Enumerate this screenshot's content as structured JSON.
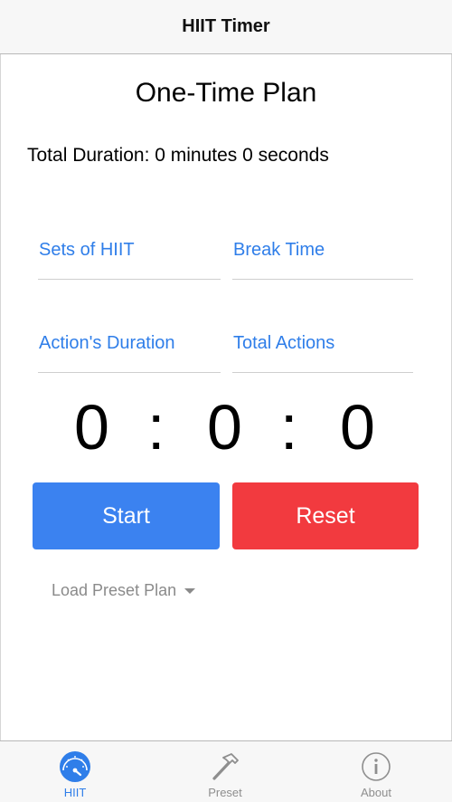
{
  "navbar": {
    "title": "HIIT Timer"
  },
  "plan": {
    "title": "One-Time Plan",
    "total_duration": "Total Duration: 0 minutes 0 seconds"
  },
  "fields": {
    "sets_of_hiit": {
      "label": "Sets of HIIT",
      "value": ""
    },
    "break_time": {
      "label": "Break Time",
      "value": ""
    },
    "actions_duration": {
      "label": "Action's Duration",
      "value": ""
    },
    "total_actions": {
      "label": "Total Actions",
      "value": ""
    }
  },
  "clock": {
    "minutes": "0",
    "separator": ":",
    "seconds": "0",
    "fraction": "0"
  },
  "buttons": {
    "start": "Start",
    "reset": "Reset"
  },
  "preset_select": {
    "label": "Load Preset Plan"
  },
  "tabs": [
    {
      "label": "HIIT",
      "icon": "speedometer-icon",
      "active": true
    },
    {
      "label": "Preset",
      "icon": "hammer-icon",
      "active": false
    },
    {
      "label": "About",
      "icon": "info-icon",
      "active": false
    }
  ],
  "colors": {
    "accent": "#2f7ee9",
    "start_button": "#3b82f0",
    "reset_button": "#f23a3f",
    "inactive": "#8e8e8e"
  }
}
